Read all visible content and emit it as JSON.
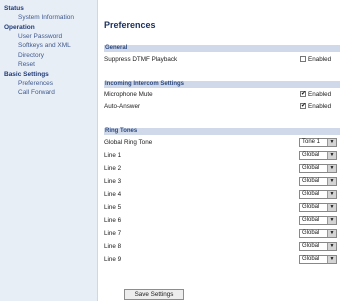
{
  "sidebar": {
    "sections": [
      {
        "title": "Status",
        "items": [
          "System Information"
        ]
      },
      {
        "title": "Operation",
        "items": [
          "User Password",
          "Softkeys and XML",
          "Directory",
          "Reset"
        ]
      },
      {
        "title": "Basic Settings",
        "items": [
          "Preferences",
          "Call Forward"
        ]
      }
    ]
  },
  "main": {
    "title": "Preferences",
    "general": {
      "header": "General",
      "suppress_dtmf": {
        "label": "Suppress DTMF Playback",
        "checked": false,
        "option": "Enabled"
      }
    },
    "intercom": {
      "header": "Incoming Intercom Settings",
      "microphone_mute": {
        "label": "Microphone Mute",
        "checked": true,
        "option": "Enabled"
      },
      "auto_answer": {
        "label": "Auto-Answer",
        "checked": true,
        "option": "Enabled"
      }
    },
    "ring_tones": {
      "header": "Ring Tones",
      "rows": [
        {
          "label": "Global Ring Tone",
          "value": "Tone 1"
        },
        {
          "label": "Line 1",
          "value": "Global"
        },
        {
          "label": "Line 2",
          "value": "Global"
        },
        {
          "label": "Line 3",
          "value": "Global"
        },
        {
          "label": "Line 4",
          "value": "Global"
        },
        {
          "label": "Line 5",
          "value": "Global"
        },
        {
          "label": "Line 6",
          "value": "Global"
        },
        {
          "label": "Line 7",
          "value": "Global"
        },
        {
          "label": "Line 8",
          "value": "Global"
        },
        {
          "label": "Line 9",
          "value": "Global"
        }
      ]
    },
    "save_label": "Save Settings"
  }
}
